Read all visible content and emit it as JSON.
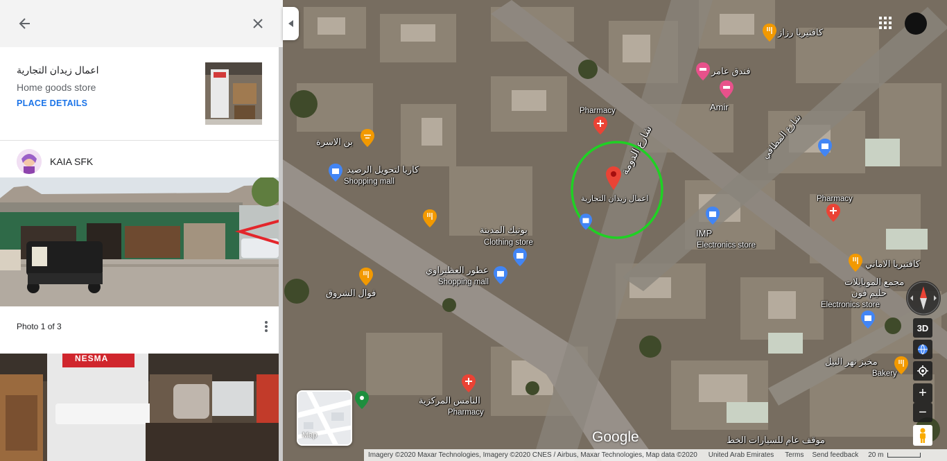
{
  "panel": {
    "back_icon": "arrow-left-icon",
    "close_icon": "close-icon",
    "place_name": "اعمال زيدان التجارية",
    "place_category": "Home goods store",
    "place_details_label": "PLACE DETAILS",
    "author_name": "KAIA SFK",
    "photo_counter": "Photo 1 of 3",
    "photo_sign_text": "NESMA",
    "more_icon": "more-vertical-icon"
  },
  "map": {
    "selected_place_label": "اعمال زيدان التجارية",
    "street_labels": [
      {
        "text": "شارع الدومة"
      },
      {
        "text": "شارع المطافي"
      }
    ],
    "places": [
      {
        "id": "cafeteria-razaz",
        "name": "كافتيريا رزاز",
        "icon": "restaurant-icon"
      },
      {
        "id": "hotel-amer",
        "name": "فندق عامر",
        "icon": "hotel-icon"
      },
      {
        "id": "hotel-amir",
        "name": "Amir",
        "icon": "hotel-icon"
      },
      {
        "id": "pharmacy-1",
        "name": "Pharmacy",
        "icon": "pharmacy-icon"
      },
      {
        "id": "ibn-alosra",
        "name": "بن الاسرة",
        "icon": "restaurant-icon"
      },
      {
        "id": "money-transfer",
        "name": "كاريا لتحويل الرصيد",
        "sub": "Shopping mall",
        "icon": "shopping-icon"
      },
      {
        "id": "medina-boutique",
        "name": "بوتيك المدينة",
        "sub": "Clothing store",
        "icon": "shopping-icon"
      },
      {
        "id": "atbarawi-perfumes",
        "name": "عطور العطبراوي",
        "sub": "Shopping mall",
        "icon": "shopping-icon"
      },
      {
        "id": "shorouq-foul",
        "name": "فوال الشروق",
        "icon": "restaurant-icon"
      },
      {
        "id": "imp-electronics",
        "name": "IMP",
        "sub": "Electronics store",
        "icon": "shopping-icon"
      },
      {
        "id": "pharmacy-2",
        "name": "Pharmacy",
        "icon": "pharmacy-icon"
      },
      {
        "id": "cafeteria-alamani",
        "name": "كافتيريا الاماني",
        "icon": "restaurant-icon"
      },
      {
        "id": "mobile-complex",
        "name": "مجمع الموبايلات",
        "sub2": "حليم فون",
        "sub": "Electronics store",
        "icon": "shopping-icon"
      },
      {
        "id": "nile-bakery",
        "name": "مخبز نهر النيل",
        "sub": "Bakery",
        "icon": "bakery-icon"
      },
      {
        "id": "alnamis-pharmacy",
        "name": "النامس المركزية",
        "sub": "Pharmacy",
        "icon": "pharmacy-icon"
      },
      {
        "id": "bus-station",
        "name": "موقف عام للسيارات الخط",
        "icon": "none"
      }
    ],
    "controls": {
      "btn_3d": "3D",
      "zoom_in": "+",
      "zoom_out": "−",
      "layer_label": "Map"
    },
    "google_logo": "Google",
    "footer": {
      "imagery": "Imagery ©2020 Maxar Technologies, Imagery ©2020 CNES / Airbus, Maxar Technologies, Map data ©2020",
      "region": "United Arab Emirates",
      "terms": "Terms",
      "feedback": "Send feedback",
      "scale": "20 m"
    }
  },
  "colors": {
    "link_blue": "#1a73e8",
    "pin_red": "#ea4335",
    "shopping_blue": "#4285f4",
    "food_orange": "#f29900",
    "hotel_pink": "#e8518b",
    "annotation_green": "#1fd124",
    "annotation_arrow_red": "#e3262b"
  }
}
